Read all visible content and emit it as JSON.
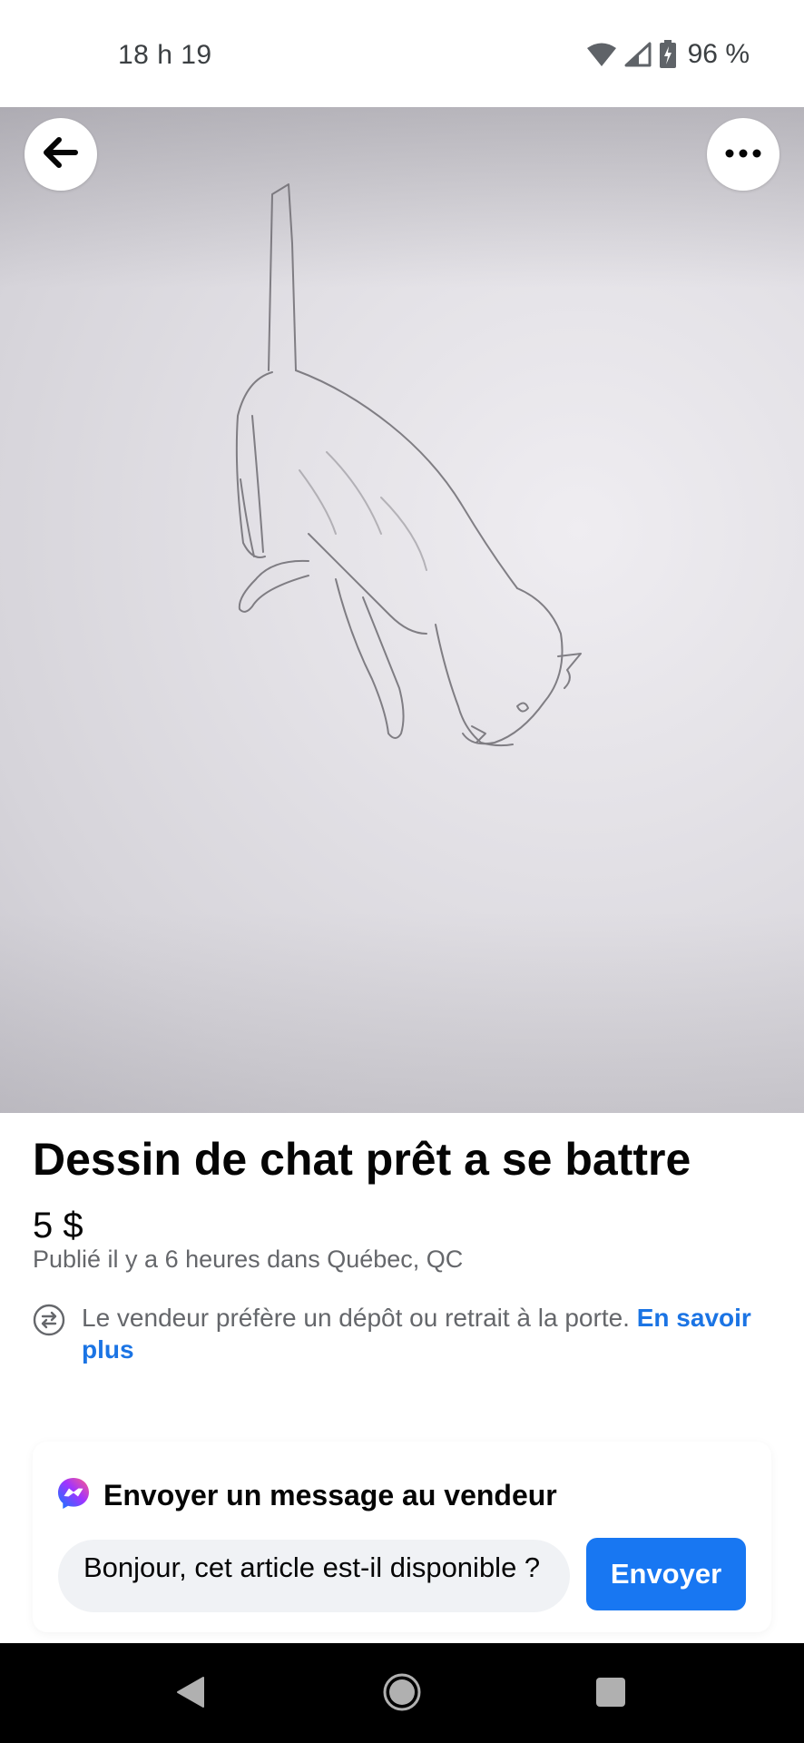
{
  "status_bar": {
    "time": "18 h 19",
    "battery": "96 %"
  },
  "listing": {
    "title": "Dessin de chat prêt a se battre",
    "price": "5 $",
    "posted": "Publié il y a 6 heures dans Québec, QC",
    "delivery_text": "Le vendeur préfère un dépôt ou retrait à la porte.",
    "learn_more": "En savoir plus"
  },
  "message": {
    "header": "Envoyer un message au vendeur",
    "input_value": "Bonjour, cet article est-il disponible ?",
    "send_label": "Envoyer"
  },
  "icons": {
    "back": "arrow-left-icon",
    "more": "more-horizontal-icon",
    "delivery": "swap-arrows-icon",
    "messenger": "messenger-icon",
    "wifi": "wifi-icon",
    "signal": "cell-signal-icon",
    "battery": "battery-charging-icon"
  },
  "colors": {
    "accent": "#1877f2",
    "link": "#1b74e4",
    "secondary_text": "#65676b"
  }
}
